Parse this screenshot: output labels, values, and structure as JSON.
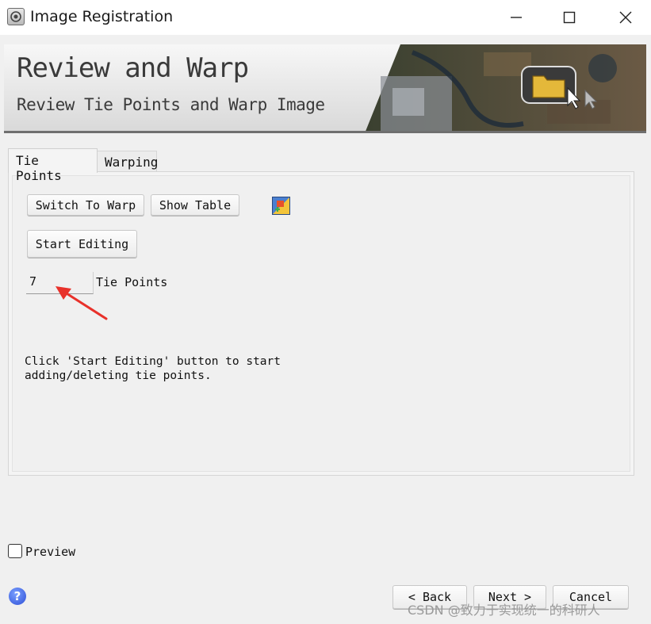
{
  "window": {
    "title": "Image Registration",
    "controls": [
      "minimize",
      "maximize",
      "close"
    ]
  },
  "banner": {
    "title": "Review and Warp",
    "subtitle": "Review Tie Points and Warp Image"
  },
  "tabs": [
    {
      "label": "Tie Points",
      "active": true
    },
    {
      "label": "Warping",
      "active": false
    }
  ],
  "tie_points_panel": {
    "switch_label": "Switch To Warp",
    "show_table_label": "Show Table",
    "start_editing_label": "Start Editing",
    "count_value": "7",
    "count_label": "Tie Points",
    "help_line1": "Click 'Start Editing' button to start",
    "help_line2": "adding/deleting tie points."
  },
  "preview": {
    "label": "Preview",
    "checked": false
  },
  "footer": {
    "back_label": "< Back",
    "next_label": "Next >",
    "cancel_label": "Cancel",
    "help_glyph": "?"
  },
  "watermark": "CSDN @致力于实现统一的科研人",
  "colors": {
    "annotation_arrow": "#e8312a",
    "window_bg": "#f0f0f0",
    "help_icon": "#2f4fd6"
  }
}
